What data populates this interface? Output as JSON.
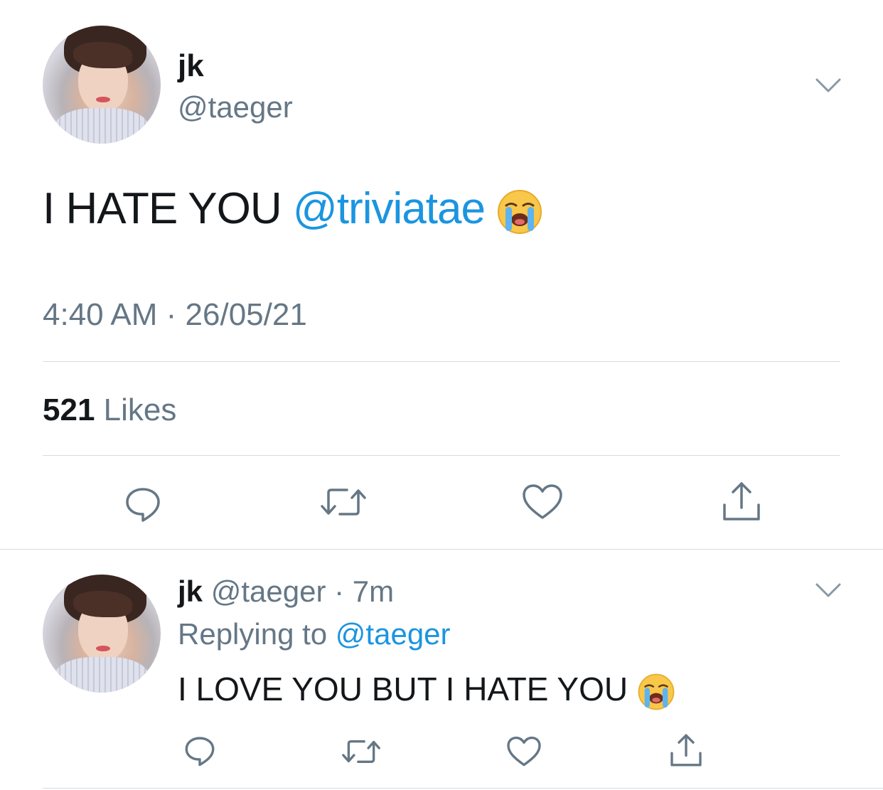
{
  "tweet": {
    "author_name": "jk",
    "author_handle": "@taeger",
    "text_before": "I HATE YOU ",
    "mention": "@triviatae",
    "emoji": "loudly-crying-face",
    "time": "4:40 AM",
    "separator": " · ",
    "date": "26/05/21",
    "likes_count": "521",
    "likes_label": " Likes"
  },
  "reply": {
    "author_name": "jk",
    "author_handle": "@taeger",
    "separator": " · ",
    "age": "7m",
    "replying_prefix": "Replying to ",
    "replying_handle": "@taeger",
    "text": "I LOVE YOU BUT I HATE YOU ",
    "emoji": "loudly-crying-face"
  },
  "icons": {
    "reply": "reply-icon",
    "retweet": "retweet-icon",
    "like": "heart-icon",
    "share": "share-icon",
    "more": "chevron-down-icon"
  },
  "colors": {
    "link": "#1b95e0",
    "secondary_text": "#657786",
    "primary_text": "#14171a",
    "divider": "#d6dbe0",
    "icon": "#657786"
  }
}
